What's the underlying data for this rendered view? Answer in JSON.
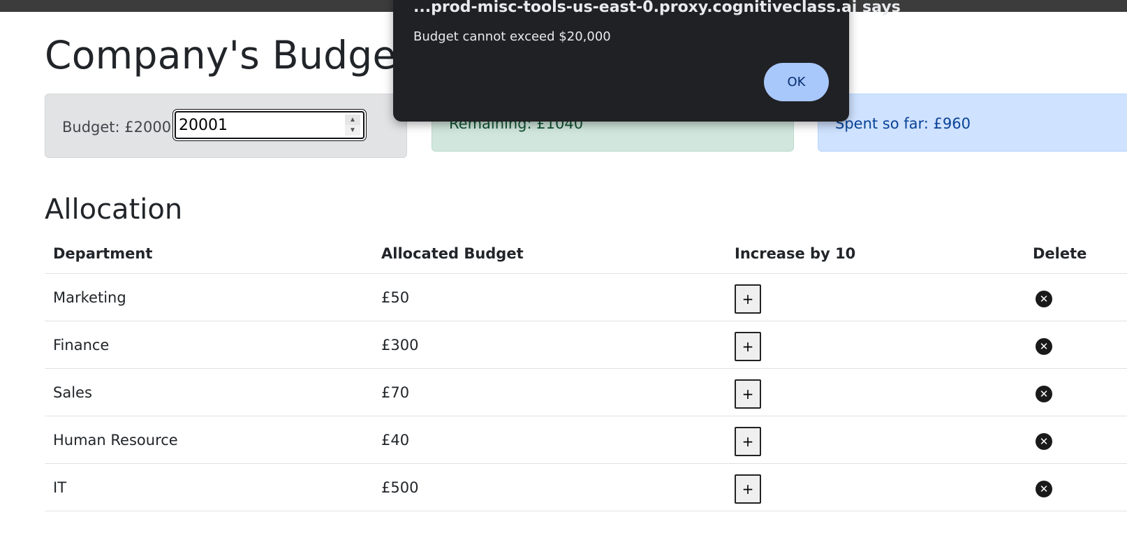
{
  "page": {
    "title": "Company's Budget Allocation"
  },
  "budget_card": {
    "label": "Budget: £20001",
    "input_value": "20001"
  },
  "remaining_card": {
    "text": "Remaining: £1040"
  },
  "spent_card": {
    "text": "Spent so far: £960"
  },
  "allocation": {
    "title": "Allocation",
    "columns": [
      "Department",
      "Allocated Budget",
      "Increase by 10",
      "Delete"
    ],
    "increase_label": "+",
    "rows": [
      {
        "department": "Marketing",
        "budget": "£50"
      },
      {
        "department": "Finance",
        "budget": "£300"
      },
      {
        "department": "Sales",
        "budget": "£70"
      },
      {
        "department": "Human Resource",
        "budget": "£40"
      },
      {
        "department": "IT",
        "budget": "£500"
      }
    ]
  },
  "dialog": {
    "title": "...prod-misc-tools-us-east-0.proxy.cognitiveclass.ai says",
    "message": "Budget cannot exceed $20,000",
    "ok_label": "OK"
  },
  "icons": {
    "spinner_up": "chevron-up-icon",
    "spinner_down": "chevron-down-icon",
    "delete": "close-circle-icon"
  }
}
